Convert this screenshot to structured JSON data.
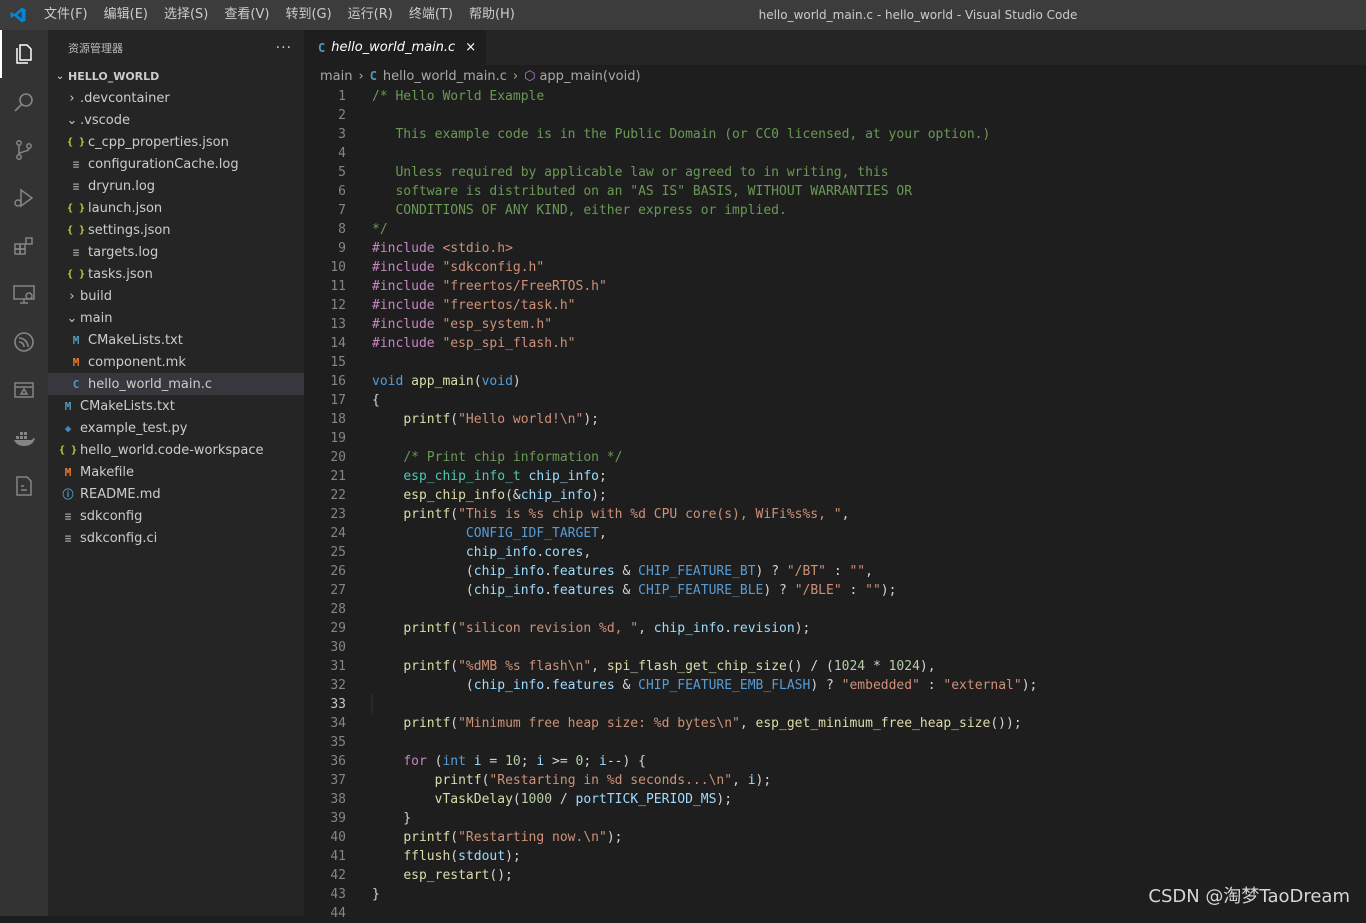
{
  "window": {
    "title": "hello_world_main.c - hello_world - Visual Studio Code"
  },
  "menu": [
    "文件(F)",
    "编辑(E)",
    "选择(S)",
    "查看(V)",
    "转到(G)",
    "运行(R)",
    "终端(T)",
    "帮助(H)"
  ],
  "activity_bar": [
    "explorer-icon",
    "search-icon",
    "source-control-icon",
    "run-debug-icon",
    "extensions-icon",
    "remote-explorer-icon",
    "espressif-icon",
    "terminal-panel-icon",
    "docker-icon",
    "cmake-icon"
  ],
  "sidebar": {
    "title": "资源管理器",
    "more": "···",
    "section": "HELLO_WORLD",
    "tree": [
      {
        "label": ".devcontainer",
        "type": "folder",
        "open": false,
        "depth": 1
      },
      {
        "label": ".vscode",
        "type": "folder",
        "open": true,
        "depth": 1
      },
      {
        "label": "c_cpp_properties.json",
        "type": "json",
        "depth": 2
      },
      {
        "label": "configurationCache.log",
        "type": "log",
        "depth": 2
      },
      {
        "label": "dryrun.log",
        "type": "log",
        "depth": 2
      },
      {
        "label": "launch.json",
        "type": "json",
        "depth": 2
      },
      {
        "label": "settings.json",
        "type": "json",
        "depth": 2
      },
      {
        "label": "targets.log",
        "type": "log",
        "depth": 2
      },
      {
        "label": "tasks.json",
        "type": "json",
        "depth": 2
      },
      {
        "label": "build",
        "type": "folder",
        "open": false,
        "depth": 1
      },
      {
        "label": "main",
        "type": "folder",
        "open": true,
        "depth": 1
      },
      {
        "label": "CMakeLists.txt",
        "type": "cmake",
        "depth": 2
      },
      {
        "label": "component.mk",
        "type": "mk",
        "depth": 2
      },
      {
        "label": "hello_world_main.c",
        "type": "c",
        "depth": 2,
        "selected": true
      },
      {
        "label": "CMakeLists.txt",
        "type": "cmake",
        "depth": 1
      },
      {
        "label": "example_test.py",
        "type": "py",
        "depth": 1
      },
      {
        "label": "hello_world.code-workspace",
        "type": "json",
        "depth": 1
      },
      {
        "label": "Makefile",
        "type": "mk",
        "depth": 1
      },
      {
        "label": "README.md",
        "type": "info",
        "depth": 1
      },
      {
        "label": "sdkconfig",
        "type": "lines",
        "depth": 1
      },
      {
        "label": "sdkconfig.ci",
        "type": "lines",
        "depth": 1
      }
    ]
  },
  "editor": {
    "tab": {
      "label": "hello_world_main.c",
      "close": "×"
    },
    "breadcrumb": {
      "folder": "main",
      "file": "hello_world_main.c",
      "symbol": "app_main(void)"
    },
    "current_line": 33,
    "lines": [
      "/* Hello World Example",
      "",
      "   This example code is in the Public Domain (or CC0 licensed, at your option.)",
      "",
      "   Unless required by applicable law or agreed to in writing, this",
      "   software is distributed on an \"AS IS\" BASIS, WITHOUT WARRANTIES OR",
      "   CONDITIONS OF ANY KIND, either express or implied.",
      "*/",
      "#include <stdio.h>",
      "#include \"sdkconfig.h\"",
      "#include \"freertos/FreeRTOS.h\"",
      "#include \"freertos/task.h\"",
      "#include \"esp_system.h\"",
      "#include \"esp_spi_flash.h\"",
      "",
      "void app_main(void)",
      "{",
      "    printf(\"Hello world!\\n\");",
      "",
      "    /* Print chip information */",
      "    esp_chip_info_t chip_info;",
      "    esp_chip_info(&chip_info);",
      "    printf(\"This is %s chip with %d CPU core(s), WiFi%s%s, \",",
      "            CONFIG_IDF_TARGET,",
      "            chip_info.cores,",
      "            (chip_info.features & CHIP_FEATURE_BT) ? \"/BT\" : \"\",",
      "            (chip_info.features & CHIP_FEATURE_BLE) ? \"/BLE\" : \"\");",
      "",
      "    printf(\"silicon revision %d, \", chip_info.revision);",
      "",
      "    printf(\"%dMB %s flash\\n\", spi_flash_get_chip_size() / (1024 * 1024),",
      "            (chip_info.features & CHIP_FEATURE_EMB_FLASH) ? \"embedded\" : \"external\");",
      "",
      "    printf(\"Minimum free heap size: %d bytes\\n\", esp_get_minimum_free_heap_size());",
      "",
      "    for (int i = 10; i >= 0; i--) {",
      "        printf(\"Restarting in %d seconds...\\n\", i);",
      "        vTaskDelay(1000 / portTICK_PERIOD_MS);",
      "    }",
      "    printf(\"Restarting now.\\n\");",
      "    fflush(stdout);",
      "    esp_restart();",
      "}",
      ""
    ]
  },
  "watermark": "CSDN @淘梦TaoDream",
  "colors": {
    "titlebar": "#3c3c3c",
    "activity": "#333333",
    "sidebar": "#252526",
    "editor": "#1e1e1e",
    "comment": "#6a9955",
    "string": "#ce9178",
    "keyword": "#569cd6"
  }
}
